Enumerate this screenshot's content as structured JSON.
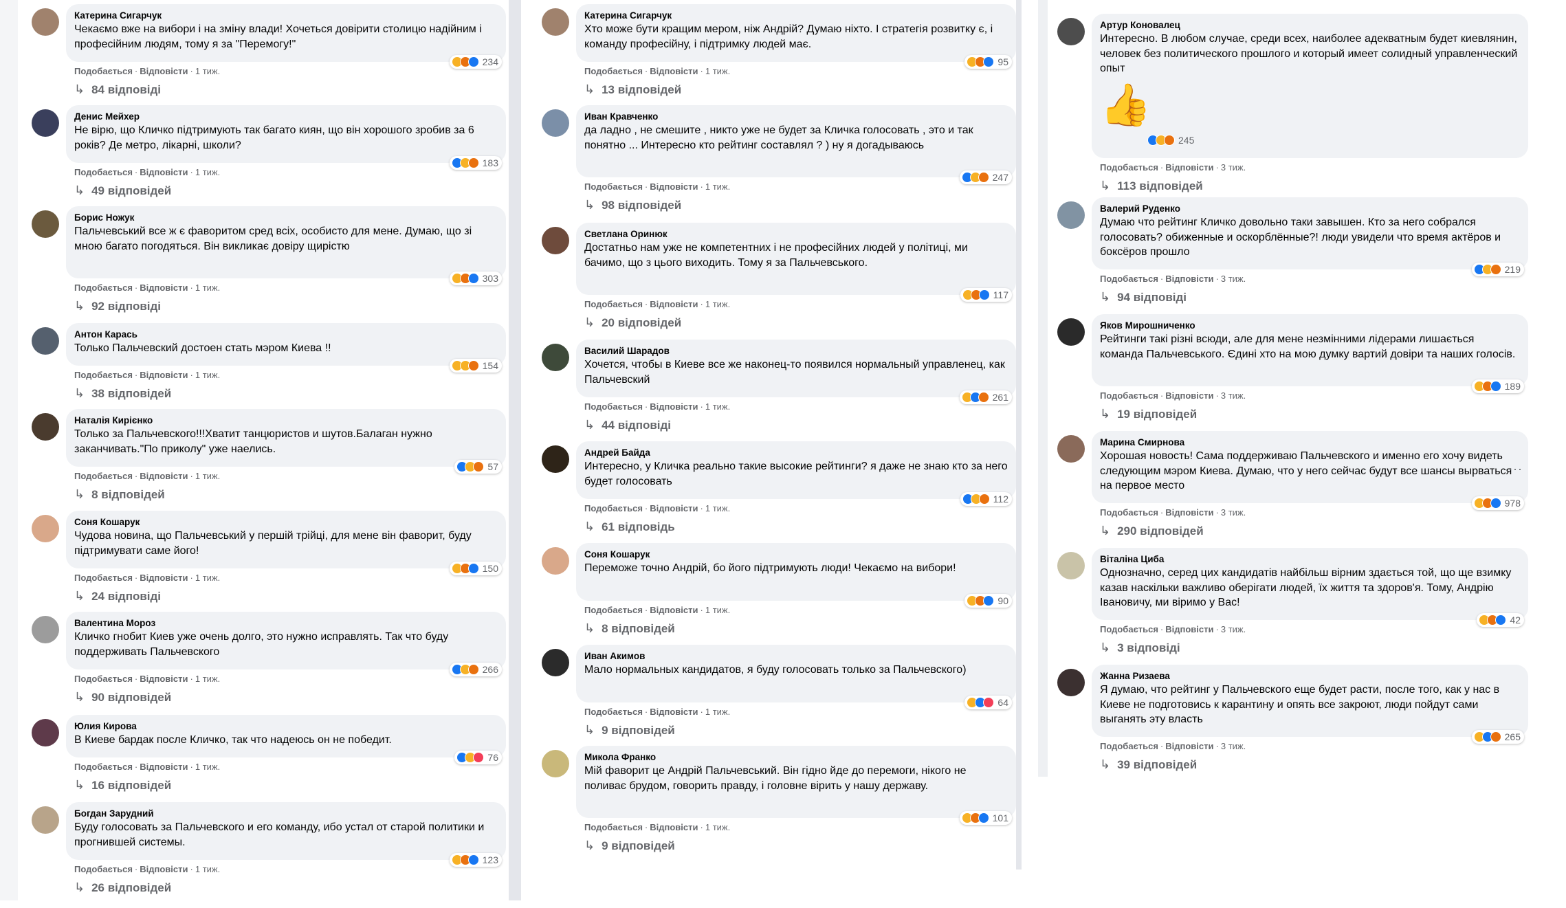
{
  "labels": {
    "like": "Подобається",
    "reply": "Відповісти"
  },
  "col1": [
    {
      "author": "Катерина Сигарчук",
      "text": "Чекаємо вже на вибори і на зміну влади! Хочеться довірити столицю надійним і професійним людям, тому я за \"Перемогу!\"",
      "reactions": [
        "care",
        "angry",
        "like"
      ],
      "count": "234",
      "time": "1 тиж.",
      "replies": "84 відповіді",
      "avatar": "#a0826d"
    },
    {
      "author": "Денис Мейхер",
      "text": "Не вірю, що Кличко підтримують так багато киян, що він хорошого зробив за 6 років? Де метро, лікарні, школи?",
      "reactions": [
        "like",
        "haha",
        "angry"
      ],
      "count": "183",
      "time": "1 тиж.",
      "replies": "49 відповідей",
      "avatar": "#3a3f5c"
    },
    {
      "author": "Борис Ножук",
      "text": "Пальчевський все ж є фаворитом сред всіх, особисто для мене. Думаю, що зі мною багато погодяться. Він викликає довіру щирістю",
      "reactions": [
        "haha",
        "angry",
        "like"
      ],
      "count": "303",
      "time": "1 тиж.",
      "replies": "92 відповіді",
      "avatar": "#6b5a3e"
    },
    {
      "author": "Антон Карась",
      "text": "Только Пальчевский достоен стать мэром Киева !!",
      "reactions": [
        "care",
        "haha",
        "angry"
      ],
      "count": "154",
      "time": "1 тиж.",
      "replies": "38 відповідей",
      "avatar": "#55606e"
    },
    {
      "author": "Наталія Кирієнко",
      "text": "Только за Пальчевского!!!Хватит танцюристов и шутов.Балаган нужно заканчивать.\"По приколу\" уже наелись.",
      "reactions": [
        "like",
        "haha",
        "angry"
      ],
      "count": "57",
      "time": "1 тиж.",
      "replies": "8 відповідей",
      "avatar": "#4a3b2e"
    },
    {
      "author": "Соня Кошарук",
      "text": "Чудова новина, що Пальчевський у першій трійці, для мене він фаворит, буду підтримувати саме його!",
      "reactions": [
        "haha",
        "angry",
        "like"
      ],
      "count": "150",
      "time": "1 тиж.",
      "replies": "24 відповіді",
      "avatar": "#d9a88a"
    },
    {
      "author": "Валентина Мороз",
      "text": "Кличко гнобит Киев уже очень долго, это нужно исправлять. Так что буду поддерживать Пальчевского",
      "reactions": [
        "like",
        "haha",
        "angry"
      ],
      "count": "266",
      "time": "1 тиж.",
      "replies": "90 відповідей",
      "avatar": "#9c9c9c"
    },
    {
      "author": "Юлия Кирова",
      "text": "В Киеве бардак после Кличко, так что надеюсь он не победит.",
      "reactions": [
        "like",
        "haha",
        "love"
      ],
      "count": "76",
      "time": "1 тиж.",
      "replies": "16 відповідей",
      "avatar": "#5e3a4a"
    },
    {
      "author": "Богдан Зарудний",
      "text": "Буду голосовать за Пальчевского и его команду, ибо устал от старой политики и прогнившей системы.",
      "reactions": [
        "haha",
        "angry",
        "like"
      ],
      "count": "123",
      "time": "1 тиж.",
      "replies": "26 відповідей",
      "avatar": "#b8a48a"
    }
  ],
  "col2": [
    {
      "author": "Катерина Сигарчук",
      "text": "Хто може бути кращим мером, ніж Андрій? Думаю ніхто. І стратегія розвитку є, і команду професійну, і підтримку людей має.",
      "reactions": [
        "haha",
        "angry",
        "like"
      ],
      "count": "95",
      "time": "1 тиж.",
      "replies": "13 відповідей",
      "avatar": "#a0826d"
    },
    {
      "author": "Иван Кравченко",
      "text": "да ладно , не смешите , никто уже не будет за Кличка голосовать , это и так понятно ... Интересно кто рейтинг составлял ? ) ну я догадываюсь",
      "reactions": [
        "like",
        "haha",
        "angry"
      ],
      "count": "247",
      "time": "1 тиж.",
      "replies": "98 відповідей",
      "avatar": "#7b8fa8"
    },
    {
      "author": "Светлана Оринюк",
      "text": "Достатньо нам уже не компетентних і не професійних людей у політиці, ми бачимо, що з цього виходить. Тому я за Пальчевського.",
      "reactions": [
        "haha",
        "angry",
        "like"
      ],
      "count": "117",
      "time": "1 тиж.",
      "replies": "20 відповідей",
      "avatar": "#6e4b3c"
    },
    {
      "author": "Василий Шарадов",
      "text": "Хочется, чтобы в Киеве все же наконец-то появился нормальный управленец, как Пальчевский",
      "reactions": [
        "haha",
        "like",
        "angry"
      ],
      "count": "261",
      "time": "1 тиж.",
      "replies": "44 відповіді",
      "avatar": "#3e4a3a"
    },
    {
      "author": "Андрей Байда",
      "text": "Интересно, у Кличка реально такие высокие рейтинги? я даже не знаю кто за него будет голосовать",
      "reactions": [
        "like",
        "haha",
        "angry"
      ],
      "count": "112",
      "time": "1 тиж.",
      "replies": "61 відповідь",
      "avatar": "#2e2418"
    },
    {
      "author": "Соня Кошарук",
      "text": "Переможе точно Андрій, бо його підтримують люди! Чекаємо на вибори!",
      "reactions": [
        "haha",
        "angry",
        "like"
      ],
      "count": "90",
      "time": "1 тиж.",
      "replies": "8 відповідей",
      "avatar": "#d9a88a"
    },
    {
      "author": "Иван Акимов",
      "text": "Мало нормальных кандидатов, я буду голосовать только за Пальчевского)",
      "reactions": [
        "haha",
        "like",
        "love"
      ],
      "count": "64",
      "time": "1 тиж.",
      "replies": "9 відповідей",
      "avatar": "#2b2b2b"
    },
    {
      "author": "Микола Франко",
      "text": "Мій фаворит це Андрій Пальчевський. Він гідно йде до перемоги, нікого не поливає брудом, говорить правду, і головне вірить у нашу державу.",
      "reactions": [
        "haha",
        "angry",
        "like"
      ],
      "count": "101",
      "time": "1 тиж.",
      "replies": "9 відповідей",
      "avatar": "#c9b87a"
    }
  ],
  "col3": [
    {
      "author": "Артур Коновалец",
      "text": "Интересно. В любом случае, среди всех, наиболее адекватным будет киевлянин, человек без политического прошлого и который имеет солидный управленческий опыт",
      "emoji": "👍",
      "reactions": [
        "like",
        "haha",
        "angry"
      ],
      "count": "245",
      "time": "3 тиж.",
      "replies": "113 відповідей",
      "avatar": "#4d4d4d"
    },
    {
      "author": "Валерий Руденко",
      "text": "Думаю что рейтинг Кличко довольно таки завышен. Кто за него собрался голосовать? обиженные и оскорблённые?! люди увидели что время актёров и боксёров прошло",
      "reactions": [
        "like",
        "haha",
        "angry"
      ],
      "count": "219",
      "time": "3 тиж.",
      "replies": "94 відповіді",
      "avatar": "#8193a3"
    },
    {
      "author": "Яков Мирошниченко",
      "text": "Рейтинги такі різні всюди, але для мене незмінними лідерами лишається команда Пальчевського. Єдині хто на мою думку вартий довіри та наших голосів.",
      "reactions": [
        "haha",
        "angry",
        "like"
      ],
      "count": "189",
      "time": "3 тиж.",
      "replies": "19 відповідей",
      "avatar": "#2a2a2a"
    },
    {
      "author": "Марина Смирнова",
      "text": "Хорошая новость! Сама поддерживаю Пальчевского и именно его хочу видеть следующим мэром Киева. Думаю, что у него сейчас будут все шансы вырваться на первое место",
      "reactions": [
        "haha",
        "angry",
        "like"
      ],
      "count": "978",
      "time": "3 тиж.",
      "replies": "290 відповідей",
      "avatar": "#8a6a5a"
    },
    {
      "author": "Віталіна Циба",
      "text": "Однозначно, серед цих кандидатів найбільш вірним здається той, що ще взимку казав наскільки важливо оберігати людей, їх життя та здоров'я. Тому, Андрію Івановичу, ми віримо у Вас!",
      "reactions": [
        "haha",
        "angry",
        "like"
      ],
      "count": "42",
      "time": "3 тиж.",
      "replies": "3 відповіді",
      "avatar": "#c9c3a8"
    },
    {
      "author": "Жанна Ризаева",
      "text": "Я думаю, что рейтинг у Пальчевского еще будет расти, после того, как у нас в Киеве не подготовись к карантину и опять все закроют, люди пойдут сами выганять эту власть",
      "reactions": [
        "haha",
        "like",
        "angry"
      ],
      "count": "265",
      "time": "3 тиж.",
      "replies": "39 відповідей",
      "avatar": "#3b3030"
    }
  ],
  "more_icon": "···"
}
